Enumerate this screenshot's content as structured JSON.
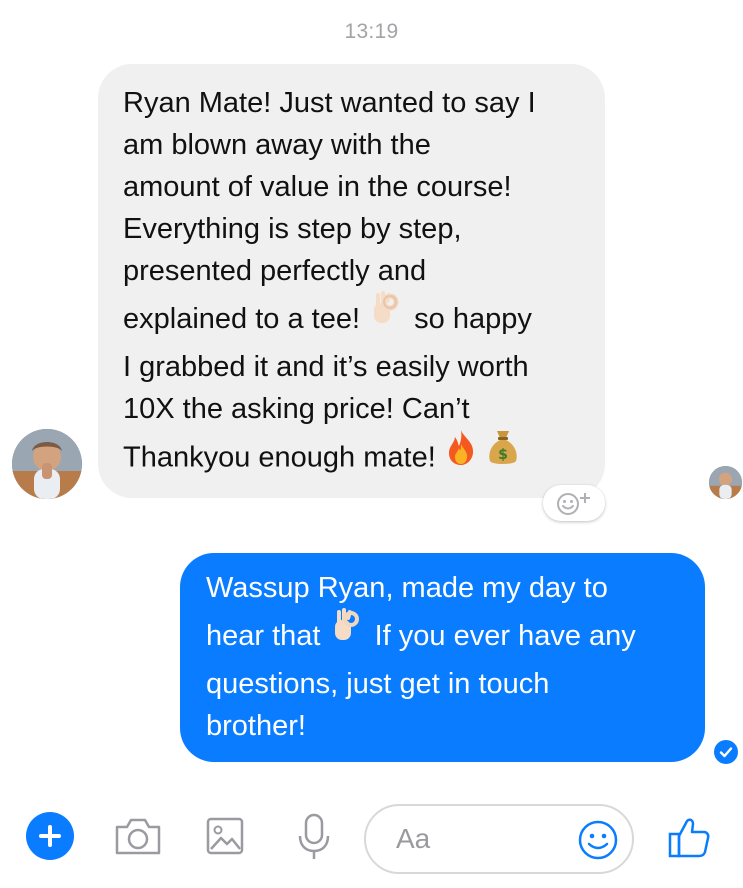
{
  "conversation": {
    "timestamp": "13:19",
    "incoming_message": {
      "lines": [
        "Ryan Mate! Just wanted to say I",
        "am blown away with the",
        "amount of value in the course!",
        "Everything is step by step,",
        "presented perfectly and",
        "explained to a tee!",
        "so happy",
        "I grabbed it and it’s easily worth",
        "10X the asking price! Can’t",
        "Thankyou enough mate!"
      ],
      "emojis": [
        "ok-hand-emoji",
        "fire-emoji",
        "money-bag-emoji"
      ]
    },
    "outgoing_message": {
      "lines": [
        "Wassup Ryan, made my day to",
        "hear that",
        "If you ever have any",
        "questions, just get in touch",
        "brother!"
      ],
      "emojis": [
        "ok-hand-emoji"
      ]
    },
    "read_receipt_icon": "contact-avatar-small",
    "sent_status_icon": "checkmark-circle-icon",
    "reaction_icon": "add-reaction-icon"
  },
  "composer": {
    "placeholder": "Aa",
    "icons": [
      "plus-icon",
      "camera-icon",
      "image-icon",
      "microphone-icon",
      "emoji-icon",
      "thumbs-up-icon"
    ]
  },
  "colors": {
    "accent": "#0a7cff",
    "incoming_bubble": "#f1f0f0",
    "timestamp": "#a3a3a8"
  }
}
